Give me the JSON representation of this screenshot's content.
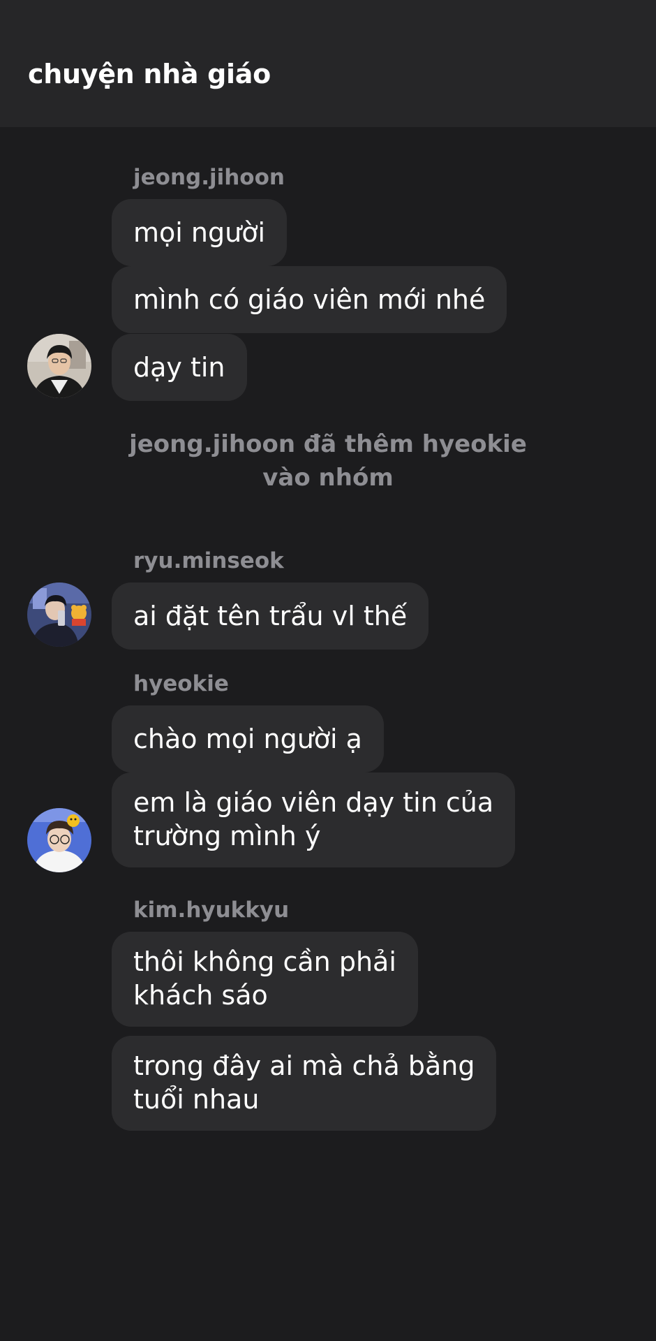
{
  "header": {
    "title": "chuyện nhà giáo"
  },
  "messages": [
    {
      "sender": "jeong.jihoon",
      "bubbles": [
        "mọi người",
        "mình có giáo viên mới nhé",
        "dạy tin"
      ]
    },
    {
      "system": "jeong.jihoon đã thêm hyeokie vào nhóm"
    },
    {
      "sender": "ryu.minseok",
      "bubbles": [
        "ai đặt tên trẩu vl thế"
      ]
    },
    {
      "sender": "hyeokie",
      "bubbles": [
        "chào mọi người ạ",
        "em là giáo viên dạy tin của\ntrường mình ý"
      ]
    },
    {
      "sender": "kim.hyukkyu",
      "bubbles": [
        "thôi không cần phải\nkhách sáo",
        "trong đây ai mà chả bằng\ntuổi nhau"
      ]
    }
  ],
  "avatars": {
    "jeong_jihoon": "avatar-photo-jeong-jihoon",
    "ryu_minseok": "avatar-photo-ryu-minseok",
    "hyeokie": "avatar-photo-hyeokie"
  },
  "colors": {
    "background": "#1c1c1e",
    "header": "#262628",
    "bubble": "#2c2c2e",
    "secondary_text": "#8e8e93",
    "primary_text": "#ffffff"
  }
}
